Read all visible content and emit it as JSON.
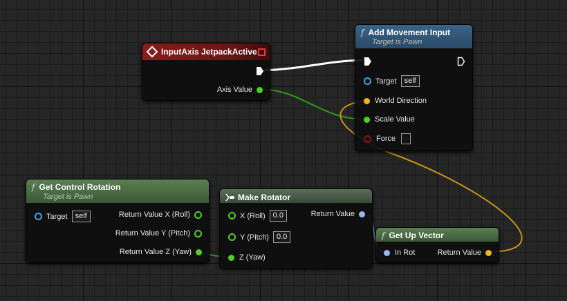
{
  "nodes": {
    "input_axis": {
      "title": "InputAxis JetpackActive",
      "axis_value": "Axis Value"
    },
    "add_movement": {
      "icon": "f",
      "title": "Add Movement Input",
      "subtitle": "Target is Pawn",
      "target_label": "Target",
      "target_value": "self",
      "world_direction_label": "World Direction",
      "scale_value_label": "Scale Value",
      "force_label": "Force"
    },
    "get_control_rotation": {
      "icon": "f",
      "title": "Get Control Rotation",
      "subtitle": "Target is Pawn",
      "target_label": "Target",
      "target_value": "self",
      "return_x": "Return Value X (Roll)",
      "return_y": "Return Value Y (Pitch)",
      "return_z": "Return Value Z (Yaw)"
    },
    "make_rotator": {
      "title": "Make Rotator",
      "x_label": "X (Roll)",
      "x_value": "0.0",
      "y_label": "Y (Pitch)",
      "y_value": "0.0",
      "z_label": "Z (Yaw)",
      "return_label": "Return Value"
    },
    "get_up_vector": {
      "icon": "f",
      "title": "Get Up Vector",
      "in_rot_label": "In Rot",
      "return_label": "Return Value"
    }
  },
  "colors": {
    "event_header": "#8a1c1c",
    "call_header": "#2e5070",
    "pure_header": "#4a6a42",
    "float_pin": "#4bd21e",
    "vector_pin": "#f0b418",
    "rotator_pin": "#9cb4f0",
    "object_pin": "#3aa6e8",
    "bool_pin": "#8c1414",
    "exec_wire": "#ffffff"
  },
  "icons": {
    "event": "event-diamond-icon",
    "function": "function-f-icon",
    "make_struct": "make-struct-icon",
    "exec": "exec-arrow-icon"
  }
}
